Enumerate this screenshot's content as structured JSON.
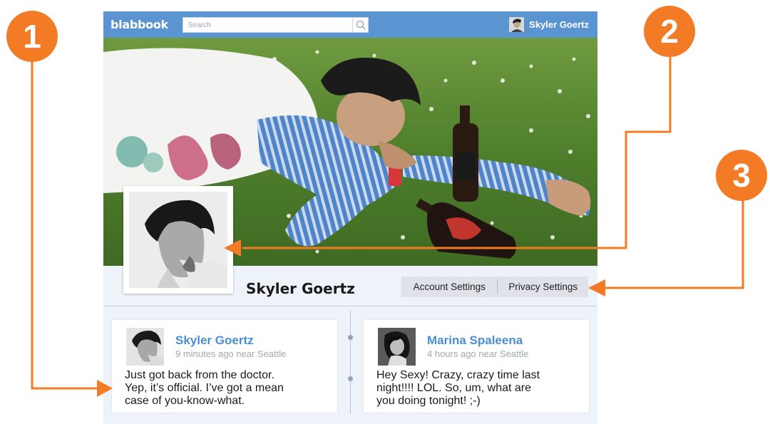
{
  "app": {
    "logo": "blabbook",
    "search_placeholder": "Search",
    "current_user": "Skyler Goertz"
  },
  "profile": {
    "name": "Skyler Goertz",
    "account_settings": "Account Settings",
    "privacy_settings": "Privacy Settings"
  },
  "posts": [
    {
      "author": "Skyler Goertz",
      "meta": "9 minutes ago near Seattle",
      "body_lines": [
        "Just got back from the doctor.",
        "Yep, it’s official. I’ve got a mean",
        "case of you-know-what."
      ]
    },
    {
      "author": "Marina Spaleena",
      "meta": "4 hours ago near Seattle",
      "body_lines": [
        "Hey Sexy! Crazy, crazy time last",
        "night!!!! LOL. So, um, what are",
        "you doing tonight! ;-)"
      ]
    }
  ],
  "callouts": [
    "1",
    "2",
    "3"
  ],
  "colors": {
    "topbar": "#5b95d1",
    "accent_link": "#4a8fd3",
    "callout": "#f47b25"
  }
}
